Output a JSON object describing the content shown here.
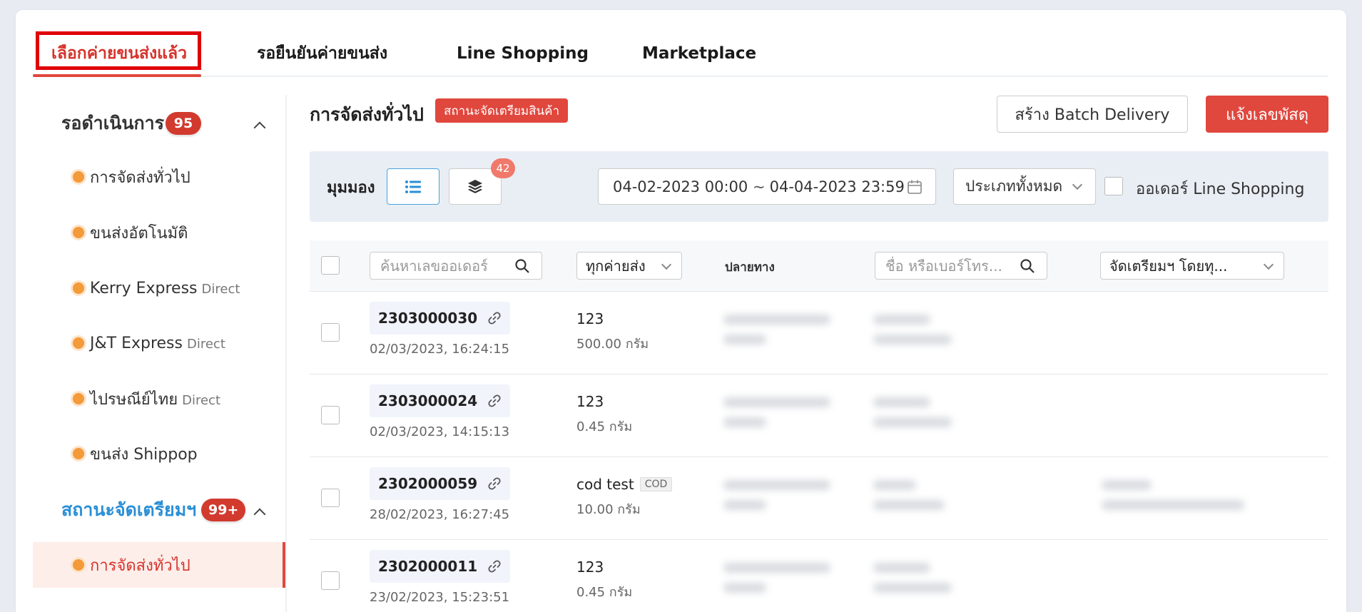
{
  "tabs": [
    {
      "label": "เลือกค่ายขนส่งแล้ว",
      "active": true
    },
    {
      "label": "รอยืนยันค่ายขนส่ง",
      "active": false
    },
    {
      "label": "Line Shopping",
      "active": false
    },
    {
      "label": "Marketplace",
      "active": false
    }
  ],
  "sidebar": {
    "group1": {
      "title": "รอดำเนินการ",
      "badge": "95",
      "items": [
        {
          "label": "การจัดส่งทั่วไป",
          "sub": ""
        },
        {
          "label": "ขนส่งอัตโนมัติ",
          "sub": ""
        },
        {
          "label": "Kerry Express",
          "sub": "Direct"
        },
        {
          "label": "J&T Express",
          "sub": "Direct"
        },
        {
          "label": "ไปรษณีย์ไทย",
          "sub": "Direct"
        },
        {
          "label": "ขนส่ง Shippop",
          "sub": ""
        }
      ]
    },
    "group2": {
      "title": "สถานะจัดเตรียมฯ",
      "badge": "99+",
      "items": [
        {
          "label": "การจัดส่งทั่วไป",
          "sub": "",
          "active": true
        }
      ]
    }
  },
  "main": {
    "title": "การจัดส่งทั่วไป",
    "status_tag": "สถานะจัดเตรียมสินค้า",
    "batch_button": "สร้าง Batch Delivery",
    "notify_button": "แจ้งเลขพัสดุ"
  },
  "filters": {
    "view_label": "มุมมอง",
    "layer_count": "42",
    "date_from": "04-02-2023 00:00",
    "date_sep": "~",
    "date_to": "04-04-2023 23:59",
    "type_select": "ประเภททั้งหมด",
    "line_shopping_label": "ออเดอร์ Line Shopping"
  },
  "table": {
    "order_search_placeholder": "ค้นหาเลขออเดอร์",
    "carrier_select": "ทุกค่ายส่ง",
    "destination_header": "ปลายทาง",
    "name_search_placeholder": "ชื่อ หรือเบอร์โทร...",
    "prep_select": "จัดเตรียมฯ โดยทุ...",
    "rows": [
      {
        "order_id": "2303000030",
        "time": "02/03/2023, 16:24:15",
        "carrier": "123",
        "cod": "",
        "weight": "500.00 กรัม"
      },
      {
        "order_id": "2303000024",
        "time": "02/03/2023, 14:15:13",
        "carrier": "123",
        "cod": "",
        "weight": "0.45 กรัม"
      },
      {
        "order_id": "2302000059",
        "time": "28/02/2023, 16:27:45",
        "carrier": "cod test",
        "cod": "COD",
        "weight": "10.00 กรัม"
      },
      {
        "order_id": "2302000011",
        "time": "23/02/2023, 15:23:51",
        "carrier": "123",
        "cod": "",
        "weight": "0.45 กรัม"
      }
    ]
  },
  "colors": {
    "accent": "#e0473d",
    "active_tab_border": "#e0000a",
    "blue_title": "#2a8fd6",
    "dot": "#f39a3a"
  }
}
